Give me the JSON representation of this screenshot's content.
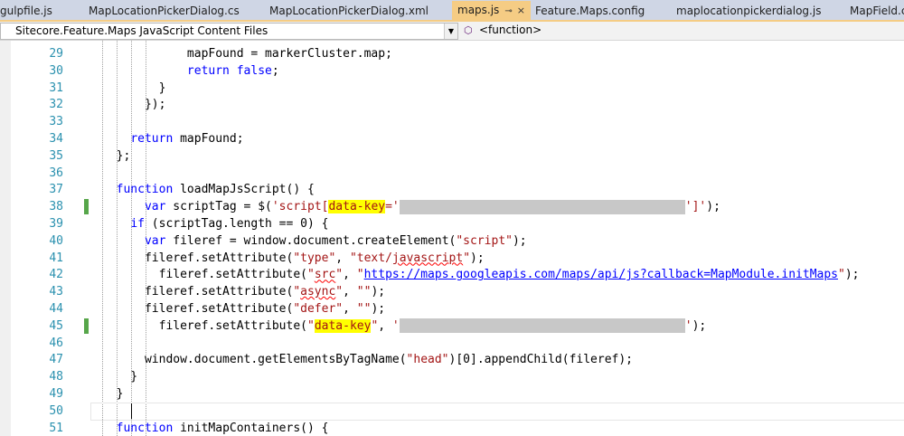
{
  "tabs": [
    {
      "label": "gulpfile.js",
      "active": false
    },
    {
      "label": "MapLocationPickerDialog.cs",
      "active": false
    },
    {
      "label": "MapLocationPickerDialog.xml",
      "active": false
    },
    {
      "label": "maps.js",
      "active": true,
      "pin": "⊸",
      "close": "×"
    },
    {
      "label": "Feature.Maps.config",
      "active": false
    },
    {
      "label": "maplocationpickerdialog.js",
      "active": false
    },
    {
      "label": "MapField.c",
      "active": false
    }
  ],
  "nav": {
    "project": "Sitecore.Feature.Maps JavaScript Content Files",
    "dropdown_glyph": "▼",
    "member_icon": "⬡",
    "member": "<function>"
  },
  "lines": [
    {
      "num": "29",
      "changed": false,
      "html": "            mapFound = markerCluster.map;"
    },
    {
      "num": "30",
      "changed": false,
      "html": "            <span class=\"kw\">return</span> <span class=\"kw\">false</span>;"
    },
    {
      "num": "31",
      "changed": false,
      "html": "        }"
    },
    {
      "num": "32",
      "changed": false,
      "html": "      });"
    },
    {
      "num": "33",
      "changed": false,
      "html": ""
    },
    {
      "num": "34",
      "changed": false,
      "html": "    <span class=\"kw\">return</span> mapFound;"
    },
    {
      "num": "35",
      "changed": false,
      "html": "  };"
    },
    {
      "num": "36",
      "changed": false,
      "html": ""
    },
    {
      "num": "37",
      "changed": false,
      "html": "  <span class=\"kw\">function</span> loadMapJsScript() {"
    },
    {
      "num": "38",
      "changed": true,
      "html": "      <span class=\"kw\">var</span> scriptTag = $(<span class=\"str\">'script[<span class=\"hl\">data-key</span>='<span class=\"redact\" style=\"width:316px\"></span>']'</span>);"
    },
    {
      "num": "39",
      "changed": false,
      "html": "    <span class=\"kw\">if</span> (scriptTag.length == 0) {"
    },
    {
      "num": "40",
      "changed": false,
      "html": "      <span class=\"kw\">var</span> fileref = window.document.createElement(<span class=\"str\">\"script\"</span>);"
    },
    {
      "num": "41",
      "changed": false,
      "html": "      fileref.setAttribute(<span class=\"str\">\"type\"</span>, <span class=\"str\">\"text/<span class=\"squig\">javascript</span>\"</span>);"
    },
    {
      "num": "42",
      "changed": false,
      "html": "        fileref.setAttribute(<span class=\"str\">\"<span class=\"squig\">src</span>\"</span>, <span class=\"str\">\"<span class=\"link\">https://maps.googleapis.com/maps/api/js?callback=MapModule.initMaps</span>\"</span>);"
    },
    {
      "num": "43",
      "changed": false,
      "html": "      fileref.setAttribute(<span class=\"str\">\"<span class=\"squig\">async</span>\"</span>, <span class=\"str\">\"\"</span>);"
    },
    {
      "num": "44",
      "changed": false,
      "html": "      fileref.setAttribute(<span class=\"str\">\"defer\"</span>, <span class=\"str\">\"\"</span>);"
    },
    {
      "num": "45",
      "changed": true,
      "html": "        fileref.setAttribute(<span class=\"str\">\"<span class=\"hl\">data-key</span>\"</span>, <span class=\"str\">'<span class=\"redact\" style=\"width:316px\"></span>'</span>);"
    },
    {
      "num": "46",
      "changed": false,
      "html": ""
    },
    {
      "num": "47",
      "changed": false,
      "html": "      window.document.getElementsByTagName(<span class=\"str\">\"head\"</span>)[0].appendChild(fileref);"
    },
    {
      "num": "48",
      "changed": false,
      "html": "    }"
    },
    {
      "num": "49",
      "changed": false,
      "html": "  }"
    },
    {
      "num": "50",
      "changed": false,
      "html": ""
    },
    {
      "num": "51",
      "changed": false,
      "html": "  <span class=\"kw\">function</span> initMapContainers() {"
    }
  ]
}
